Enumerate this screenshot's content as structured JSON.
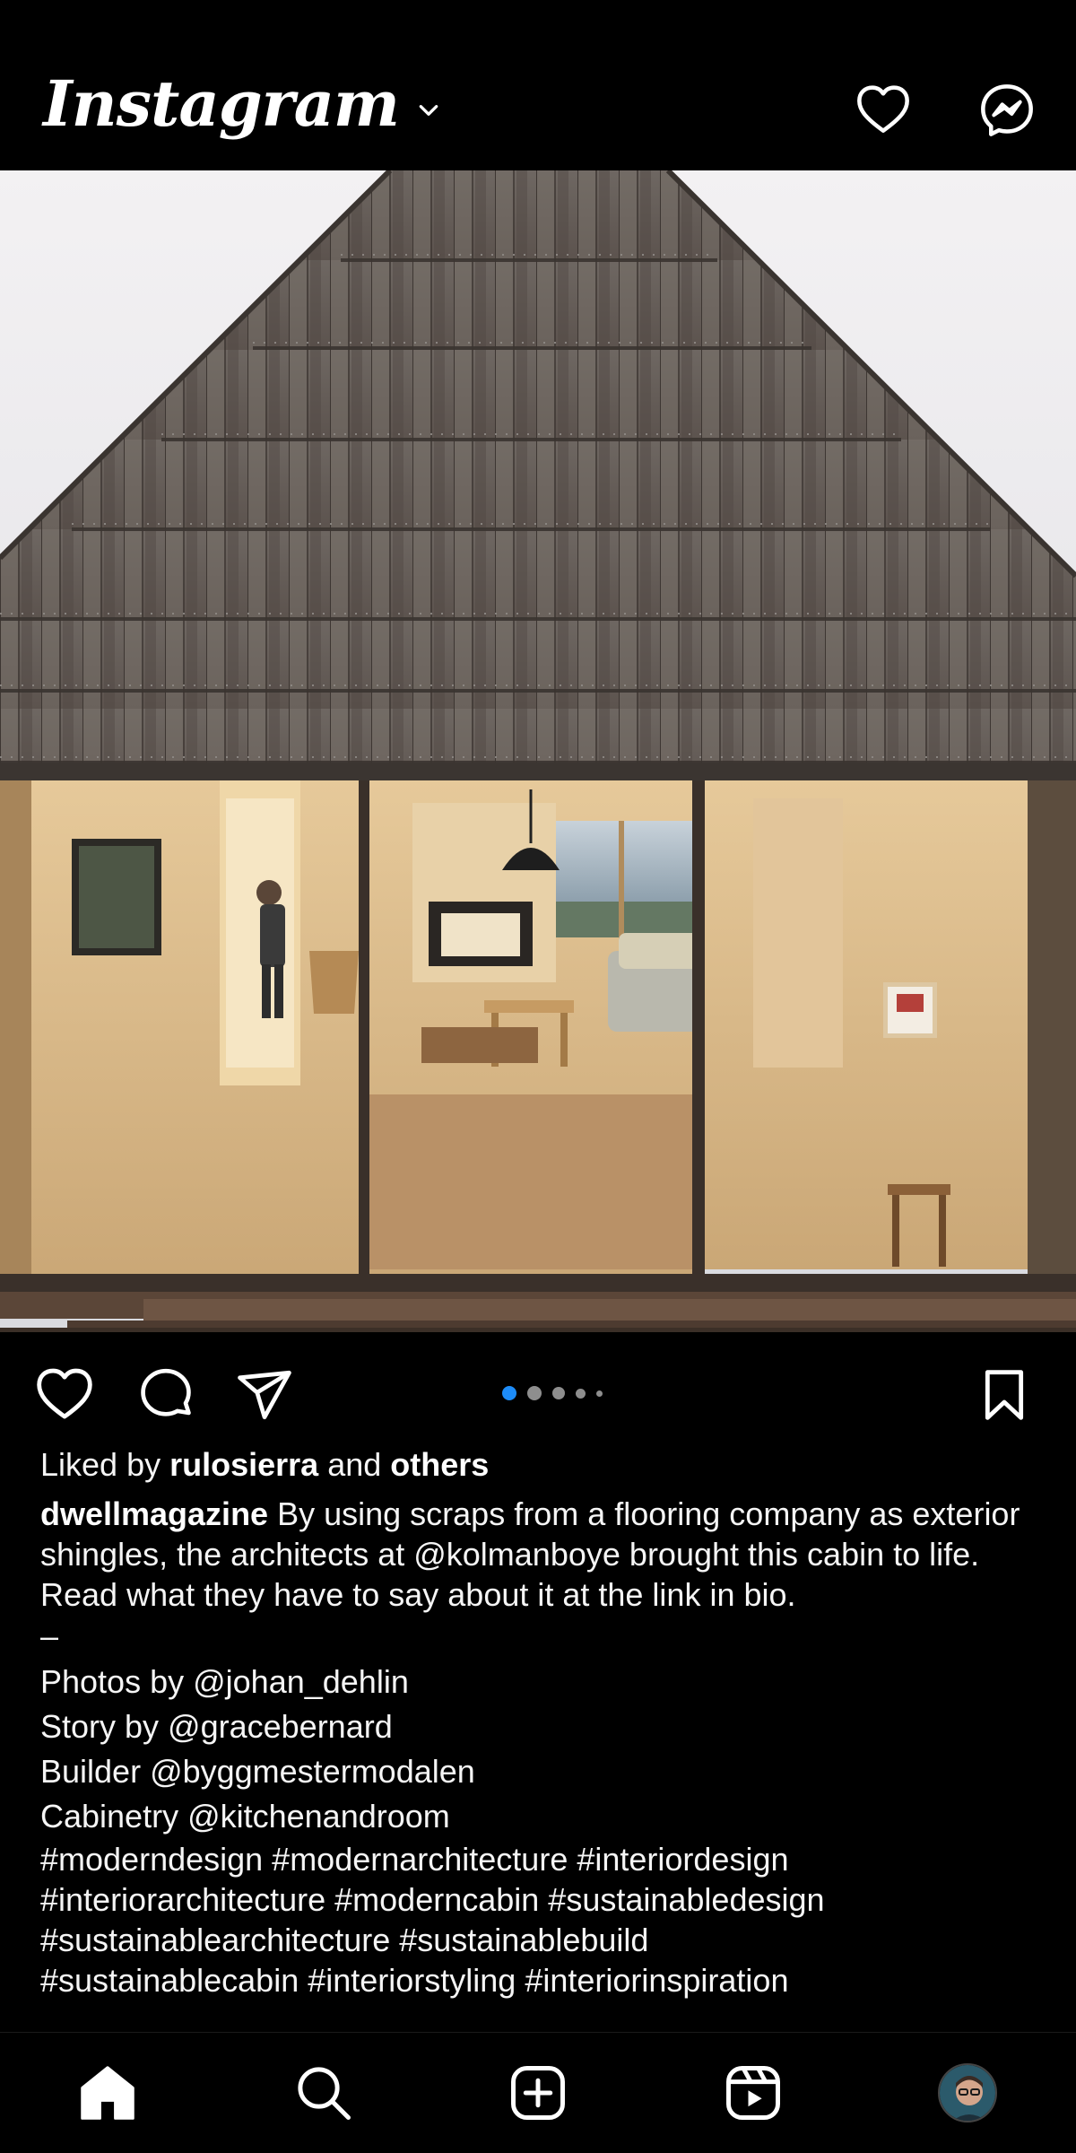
{
  "header": {
    "logo_text": "Instagram",
    "logo_dropdown_icon": "chevron-down-icon",
    "activity_icon": "heart-icon",
    "messenger_icon": "messenger-icon"
  },
  "post": {
    "image_alt_icon": "photo",
    "carousel": {
      "total": 5,
      "active_index": 0
    },
    "actions": {
      "like_icon": "heart-icon",
      "comment_icon": "comment-icon",
      "share_icon": "paper-plane-icon",
      "save_icon": "bookmark-icon"
    },
    "likes": {
      "prefix": "Liked by",
      "user": "rulosierra",
      "joiner": "and",
      "others": "others"
    },
    "caption": {
      "username": "dwellmagazine",
      "text_before_mention": "By using scraps from a flooring company as exterior shingles, the architects at",
      "mention": "@kolmanboye",
      "text_after_mention": "brought this cabin to life. Read what they have to say about it at the link in bio.",
      "separator": "–",
      "credits": [
        "Photos by @johan_dehlin",
        "Story by @gracebernard",
        "Builder @byggmestermodalen",
        "Cabinetry @kitchenandroom"
      ],
      "hashtags": [
        "#moderndesign #modernarchitecture #interiordesign",
        "#interiorarchitecture #moderncabin #sustainabledesign",
        "#sustainablearchitecture #sustainablebuild",
        "#sustainablecabin #interiorstyling #interiorinspiration"
      ]
    }
  },
  "bottom_nav": {
    "items": [
      "home-icon",
      "search-icon",
      "create-icon",
      "reels-icon",
      "profile-avatar"
    ],
    "active": "home-icon"
  },
  "colors": {
    "background": "#000000",
    "text": "#f5f5f5",
    "accent_dot": "#1d8cf8",
    "inactive_dot": "#8e8e8e"
  }
}
